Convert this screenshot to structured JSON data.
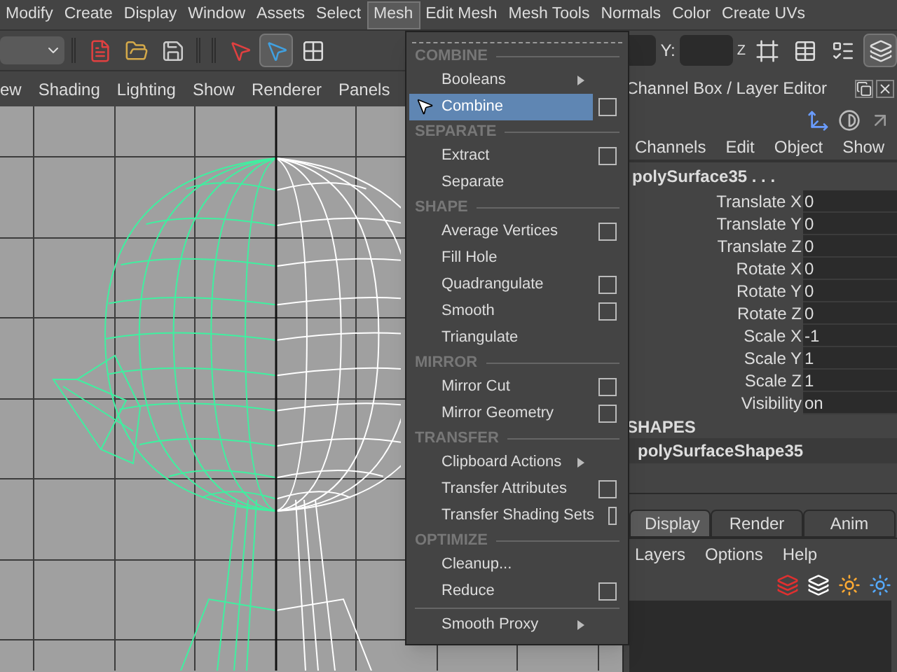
{
  "menubar": [
    {
      "label": "Modify",
      "selected": false
    },
    {
      "label": "Create",
      "selected": false
    },
    {
      "label": "Display",
      "selected": false
    },
    {
      "label": "Window",
      "selected": false
    },
    {
      "label": "Assets",
      "selected": false
    },
    {
      "label": "Select",
      "selected": false
    },
    {
      "label": "Mesh",
      "selected": true
    },
    {
      "label": "Edit Mesh",
      "selected": false
    },
    {
      "label": "Mesh Tools",
      "selected": false
    },
    {
      "label": "Normals",
      "selected": false
    },
    {
      "label": "Color",
      "selected": false
    },
    {
      "label": "Create UVs",
      "selected": false
    }
  ],
  "toolbar": {
    "y_label": "Y:",
    "z_label": "Z"
  },
  "viewport": {
    "menu": [
      "ew",
      "Shading",
      "Lighting",
      "Show",
      "Renderer",
      "Panels"
    ]
  },
  "mesh_menu": {
    "sections": [
      {
        "title": "COMBINE",
        "items": [
          {
            "label": "Booleans",
            "kind": "submenu",
            "selected": false
          },
          {
            "label": "Combine",
            "kind": "option",
            "selected": true
          }
        ]
      },
      {
        "title": "SEPARATE",
        "items": [
          {
            "label": "Extract",
            "kind": "option",
            "selected": false
          },
          {
            "label": "Separate",
            "kind": "plain",
            "selected": false
          }
        ]
      },
      {
        "title": "SHAPE",
        "items": [
          {
            "label": "Average Vertices",
            "kind": "option",
            "selected": false
          },
          {
            "label": "Fill Hole",
            "kind": "plain",
            "selected": false
          },
          {
            "label": "Quadrangulate",
            "kind": "option",
            "selected": false
          },
          {
            "label": "Smooth",
            "kind": "option",
            "selected": false
          },
          {
            "label": "Triangulate",
            "kind": "plain",
            "selected": false
          }
        ]
      },
      {
        "title": "MIRROR",
        "items": [
          {
            "label": "Mirror Cut",
            "kind": "option",
            "selected": false
          },
          {
            "label": "Mirror Geometry",
            "kind": "option",
            "selected": false
          }
        ]
      },
      {
        "title": "TRANSFER",
        "items": [
          {
            "label": "Clipboard Actions",
            "kind": "submenu",
            "selected": false
          },
          {
            "label": "Transfer Attributes",
            "kind": "option",
            "selected": false
          },
          {
            "label": "Transfer Shading Sets",
            "kind": "option",
            "selected": false
          }
        ]
      },
      {
        "title": "OPTIMIZE",
        "items": [
          {
            "label": "Cleanup...",
            "kind": "plain",
            "selected": false
          },
          {
            "label": "Reduce",
            "kind": "option",
            "selected": false
          }
        ]
      },
      {
        "items": [
          {
            "label": "Smooth Proxy",
            "kind": "submenu",
            "selected": false
          }
        ]
      }
    ]
  },
  "channel_box": {
    "title": "Channel Box / Layer Editor",
    "menu": [
      "Channels",
      "Edit",
      "Object",
      "Show"
    ],
    "object_name": "polySurface35 . . .",
    "attributes": [
      {
        "name": "Translate X",
        "value": "0"
      },
      {
        "name": "Translate Y",
        "value": "0"
      },
      {
        "name": "Translate Z",
        "value": "0"
      },
      {
        "name": "Rotate X",
        "value": "0"
      },
      {
        "name": "Rotate Y",
        "value": "0"
      },
      {
        "name": "Rotate Z",
        "value": "0"
      },
      {
        "name": "Scale X",
        "value": "-1"
      },
      {
        "name": "Scale Y",
        "value": "1"
      },
      {
        "name": "Scale Z",
        "value": "1"
      },
      {
        "name": "Visibility",
        "value": "on"
      }
    ],
    "shapes_title": "SHAPES",
    "shape_name": "polySurfaceShape35"
  },
  "layer_editor": {
    "tabs": [
      {
        "label": "Display",
        "selected": true
      },
      {
        "label": "Render",
        "selected": false
      },
      {
        "label": "Anim",
        "selected": false
      }
    ],
    "menu": [
      "Layers",
      "Options",
      "Help"
    ]
  }
}
